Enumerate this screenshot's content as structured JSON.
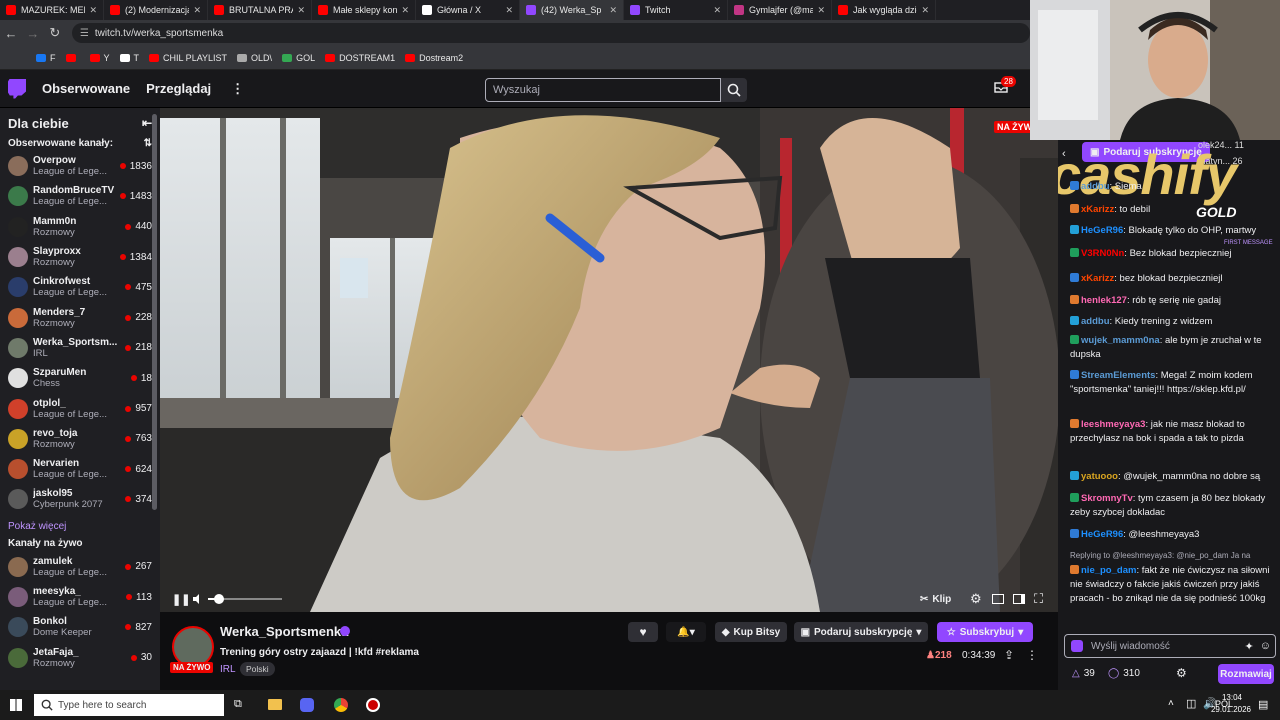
{
  "browser": {
    "tabs": [
      {
        "title": "MAZUREK: MENT",
        "color": "#ff0000"
      },
      {
        "title": "(2) Modernizacja",
        "color": "#ff0000"
      },
      {
        "title": "BRUTALNA PRAW",
        "color": "#ff0000"
      },
      {
        "title": "Małe sklepy kont",
        "color": "#ff0000"
      },
      {
        "title": "Główna / X",
        "color": "#ffffff"
      },
      {
        "title": "(42) Werka_Sp",
        "color": "#9147ff"
      },
      {
        "title": "Twitch",
        "color": "#9147ff"
      },
      {
        "title": "Gymlajfer (@mac",
        "color": "#c13584"
      },
      {
        "title": "Jak wygląda dzie",
        "color": "#ff0000"
      }
    ],
    "url": "twitch.tv/werka_sportsmenka",
    "bookmarks": [
      {
        "label": "F",
        "color": "#1877f2"
      },
      {
        "label": "",
        "color": "#ff0000"
      },
      {
        "label": "Y",
        "color": "#ff0000"
      },
      {
        "label": "T",
        "color": "#ffffff"
      },
      {
        "label": "CHIL PLAYLIST",
        "color": "#ff0000"
      },
      {
        "label": "OLD\\",
        "color": "#aaaaaa"
      },
      {
        "label": "GOL",
        "color": "#34a853"
      },
      {
        "label": "DOSTREAM1",
        "color": "#ff0000"
      },
      {
        "label": "Dostream2",
        "color": "#ff0000"
      }
    ]
  },
  "nav": {
    "following": "Obserwowane",
    "browse": "Przeglądaj",
    "search_placeholder": "Wyszukaj",
    "notif_count": "28"
  },
  "sidebar": {
    "header": "Dla ciebie",
    "followed_title": "Obserwowane kanały:",
    "channels": [
      {
        "name": "Overpow",
        "game": "League of Lege...",
        "viewers": "1836",
        "color": "#8a6d5b"
      },
      {
        "name": "RandomBruceTV",
        "game": "League of Lege...",
        "viewers": "1483",
        "color": "#3b7a4a"
      },
      {
        "name": "Mamm0n",
        "game": "Rozmowy",
        "viewers": "440",
        "color": "#222222"
      },
      {
        "name": "Slayproxx",
        "game": "Rozmowy",
        "viewers": "1384",
        "color": "#9b7f8e"
      },
      {
        "name": "Cinkrofwest",
        "game": "League of Lege...",
        "viewers": "475",
        "color": "#2a3d6b"
      },
      {
        "name": "Menders_7",
        "game": "Rozmowy",
        "viewers": "228",
        "color": "#c96a3a"
      },
      {
        "name": "Werka_Sportsm...",
        "game": "IRL",
        "viewers": "218",
        "color": "#6f7a6a"
      },
      {
        "name": "SzparuMen",
        "game": "Chess",
        "viewers": "18",
        "color": "#e0e0e0"
      },
      {
        "name": "otplol_",
        "game": "League of Lege...",
        "viewers": "957",
        "color": "#d0402a"
      },
      {
        "name": "revo_toja",
        "game": "Rozmowy",
        "viewers": "763",
        "color": "#c9a227"
      },
      {
        "name": "Nervarien",
        "game": "League of Lege...",
        "viewers": "624",
        "color": "#b84f2e"
      },
      {
        "name": "jaskol95",
        "game": "Cyberpunk 2077",
        "viewers": "374",
        "color": "#5a5a5a"
      }
    ],
    "show_more": "Pokaż więcej",
    "live_title": "Kanały na żywo",
    "live": [
      {
        "name": "zamulek",
        "game": "League of Lege...",
        "viewers": "267",
        "color": "#8a6a50"
      },
      {
        "name": "meesyka_",
        "game": "League of Lege...",
        "viewers": "113",
        "color": "#7a5c7a"
      },
      {
        "name": "Bonkol",
        "game": "Dome Keeper",
        "viewers": "827",
        "color": "#3a4a5a"
      },
      {
        "name": "JetaFaja_",
        "game": "Rozmowy",
        "viewers": "30",
        "color": "#4a6a3a"
      }
    ]
  },
  "video": {
    "live_label": "NA ŻYW",
    "clip_label": "Klip",
    "volume": 0.15
  },
  "stream": {
    "channel": "Werka_Sportsmenka",
    "title": "Trening góry ostry zajaazd | !kfd #reklama",
    "category": "IRL",
    "tag": "Polski",
    "live_badge": "NA ŻYWO",
    "viewers": "218",
    "uptime": "0:34:39",
    "buy_bits": "Kup Bitsy",
    "gift_sub": "Podaruj subskrypcję",
    "subscribe": "Subskrybuj"
  },
  "chat": {
    "gift_banner": "Podaruj subskrypcję",
    "overlay_brand": "cashify",
    "overlay_sub": "GOLD",
    "top_users": [
      {
        "name": "olek24...",
        "count": "11"
      },
      {
        "name": "matyn...",
        "count": "26"
      }
    ],
    "messages": [
      {
        "user": "addbu",
        "text": "Siema",
        "color": "#5b9bd5"
      },
      {
        "user": "xKarizz",
        "text": "to debil",
        "color": "#ff4500"
      },
      {
        "user": "HeGeR96",
        "text": "Blokadę tylko do OHP, martwy",
        "color": "#1e90ff"
      },
      {
        "user": "V3RN0Nn",
        "text": "Bez blokad bezpieczniej",
        "color": "#ff0000"
      },
      {
        "user": "xKarizz",
        "text": "bez blokad bezpieczniejl",
        "color": "#ff4500"
      },
      {
        "user": "henlek127",
        "text": "rób tę serię nie gadaj",
        "color": "#ff69b4"
      },
      {
        "user": "addbu",
        "text": "Kiedy trening z widzem",
        "color": "#5b9bd5"
      },
      {
        "user": "wujek_mamm0na",
        "text": "ale bym je zruchał w te dupska",
        "color": "#5b9bd5"
      },
      {
        "user": "StreamElements",
        "text": "Mega! Z moim kodem \"sportsmenka\" taniej!!! https://sklep.kfd.pl/",
        "color": "#5b9bd5"
      },
      {
        "user": "leeshmeyaya3",
        "text": "jak nie masz blokad to przechylasz na bok i spada a tak to pizda",
        "color": "#ff69b4"
      },
      {
        "user": "yatuooo",
        "text": "@wujek_mamm0na no dobre są",
        "color": "#daa520"
      },
      {
        "user": "SkromnyTv",
        "text": "tym czasem ja 80 bez blokady zeby szybcej dokladac",
        "color": "#ff69b4"
      },
      {
        "user": "HeGeR96",
        "text": "@leeshmeyaya3",
        "color": "#1e90ff"
      },
      {
        "user": "nie_po_dam",
        "text": "fakt że nie ćwiczysz na siłowni nie świadczy o fakcie jakiś ćwiczeń przy jakiś pracach - bo znikąd nie da się podnieść 100kg",
        "color": "#1e90ff"
      }
    ],
    "reply_to": "Replying to @leeshmeyaya3: @nie_po_dam Ja na",
    "first_message": "FIRST MESSAGE",
    "input_placeholder": "Wyślij wiadomość",
    "points": "39",
    "bits": "310",
    "send": "Rozmawiaj"
  },
  "taskbar": {
    "search": "Type here to search",
    "lang": "POL",
    "time": "13:04",
    "date": "29.01.2026"
  }
}
